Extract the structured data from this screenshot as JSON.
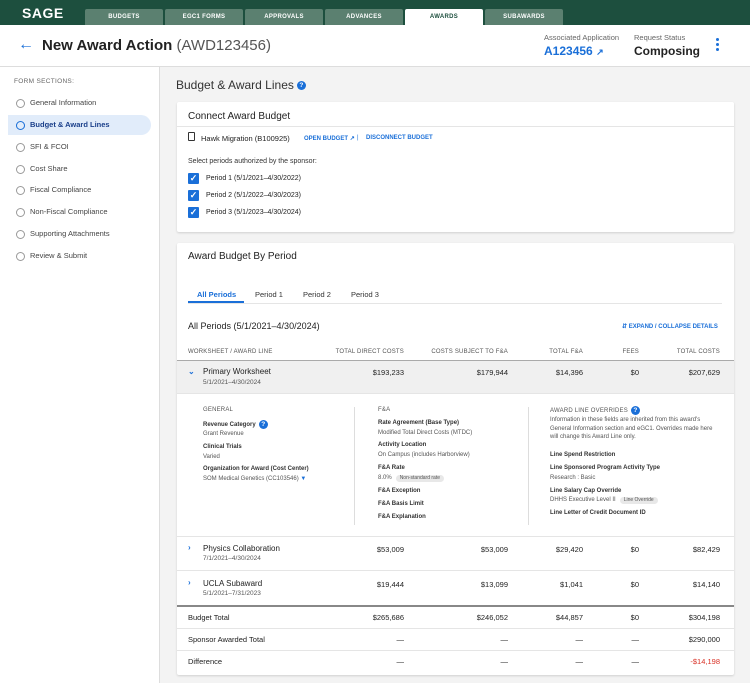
{
  "app": {
    "logo": "SAGE"
  },
  "nav_tabs": [
    {
      "label": "BUDGETS",
      "active": false
    },
    {
      "label": "EGC1 FORMS",
      "active": false
    },
    {
      "label": "APPROVALS",
      "active": false
    },
    {
      "label": "ADVANCES",
      "active": false
    },
    {
      "label": "AWARDS",
      "active": true
    },
    {
      "label": "SUBAWARDS",
      "active": false
    }
  ],
  "header": {
    "title": "New Award Action",
    "code": "(AWD123456)",
    "assoc_label": "Associated Application",
    "assoc_value": "A123456",
    "status_label": "Request Status",
    "status_value": "Composing"
  },
  "sidebar": {
    "heading": "FORM SECTIONS:",
    "items": [
      {
        "label": "General Information",
        "active": false
      },
      {
        "label": "Budget & Award Lines",
        "active": true
      },
      {
        "label": "SFI & FCOI",
        "active": false
      },
      {
        "label": "Cost Share",
        "active": false
      },
      {
        "label": "Fiscal Compliance",
        "active": false
      },
      {
        "label": "Non-Fiscal Compliance",
        "active": false
      },
      {
        "label": "Supporting Attachments",
        "active": false
      },
      {
        "label": "Review & Submit",
        "active": false
      }
    ]
  },
  "section_title": "Budget & Award Lines",
  "connect": {
    "title": "Connect Award Budget",
    "budget_name": "Hawk Migration (B100925)",
    "open_label": "OPEN BUDGET",
    "separator": "|",
    "disconnect_label": "DISCONNECT BUDGET",
    "select_label": "Select periods authorized by the sponsor:",
    "periods": [
      {
        "label": "Period 1 (5/1/2021–4/30/2022)",
        "checked": true
      },
      {
        "label": "Period 2 (5/1/2022–4/30/2023)",
        "checked": true
      },
      {
        "label": "Period 3 (5/1/2023–4/30/2024)",
        "checked": true
      }
    ]
  },
  "award_budget": {
    "title": "Award Budget By Period",
    "tabs": [
      "All Periods",
      "Period 1",
      "Period 2",
      "Period 3"
    ],
    "active_tab": "All Periods",
    "range_title": "All Periods (5/1/2021–4/30/2024)",
    "expand_label": "EXPAND / COLLAPSE DETAILS",
    "columns": [
      "WORKSHEET / AWARD LINE",
      "TOTAL DIRECT COSTS",
      "COSTS SUBJECT TO F&A",
      "TOTAL F&A",
      "FEES",
      "TOTAL COSTS"
    ],
    "rows": [
      {
        "name": "Primary Worksheet",
        "dates": "5/1/2021–4/30/2024",
        "tdc": "$193,233",
        "csfa": "$179,944",
        "fa": "$14,396",
        "fees": "$0",
        "total": "$207,629",
        "expanded": true
      },
      {
        "name": "Physics Collaboration",
        "dates": "7/1/2021–4/30/2024",
        "tdc": "$53,009",
        "csfa": "$53,009",
        "fa": "$29,420",
        "fees": "$0",
        "total": "$82,429",
        "expanded": false
      },
      {
        "name": "UCLA Subaward",
        "dates": "5/1/2021–7/31/2023",
        "tdc": "$19,444",
        "csfa": "$13,099",
        "fa": "$1,041",
        "fees": "$0",
        "total": "$14,140",
        "expanded": false
      }
    ],
    "details": {
      "general_head": "GENERAL",
      "revenue_category_label": "Revenue Category",
      "revenue_category_value": "Grant Revenue",
      "clinical_trials_label": "Clinical Trials",
      "clinical_trials_value": "Varied",
      "org_label": "Organization for Award (Cost Center)",
      "org_value": "SOM Medical Genetics (CC103546)",
      "fa_head": "F&A",
      "rate_agreement_label": "Rate Agreement (Base Type)",
      "rate_agreement_value": "Modified Total Direct Costs (MTDC)",
      "activity_location_label": "Activity Location",
      "activity_location_value": "On Campus (includes Harborview)",
      "fa_rate_label": "F&A Rate",
      "fa_rate_value": "8.0%",
      "fa_rate_pill": "Non-standard rate",
      "fa_exception_label": "F&A Exception",
      "fa_basis_label": "F&A Basis Limit",
      "fa_explanation_label": "F&A Explanation",
      "overrides_head": "AWARD LINE OVERRIDES",
      "overrides_note": "Information in these fields are inherited from this award's General Information section and eGC1. Overrides made here will change this Award Line only.",
      "line_spend_label": "Line Spend Restriction",
      "activity_type_label": "Line Sponsored Program Activity Type",
      "activity_type_value": "Research : Basic",
      "salary_cap_label": "Line Salary Cap Override",
      "salary_cap_value": "DHHS Executive Level II",
      "salary_cap_pill": "Line Override",
      "letter_credit_label": "Line Letter of Credit Document ID"
    },
    "totals": [
      {
        "label": "Budget Total",
        "tdc": "$265,686",
        "csfa": "$246,052",
        "fa": "$44,857",
        "fees": "$0",
        "total": "$304,198"
      },
      {
        "label": "Sponsor Awarded Total",
        "tdc": "—",
        "csfa": "—",
        "fa": "—",
        "fees": "—",
        "total": "$290,000"
      },
      {
        "label": "Difference",
        "tdc": "—",
        "csfa": "—",
        "fa": "—",
        "fees": "—",
        "total": "-$14,198"
      }
    ]
  },
  "colors": {
    "brand": "#1d4f3e",
    "accent": "#1a6fd8",
    "negative": "#d93025"
  }
}
